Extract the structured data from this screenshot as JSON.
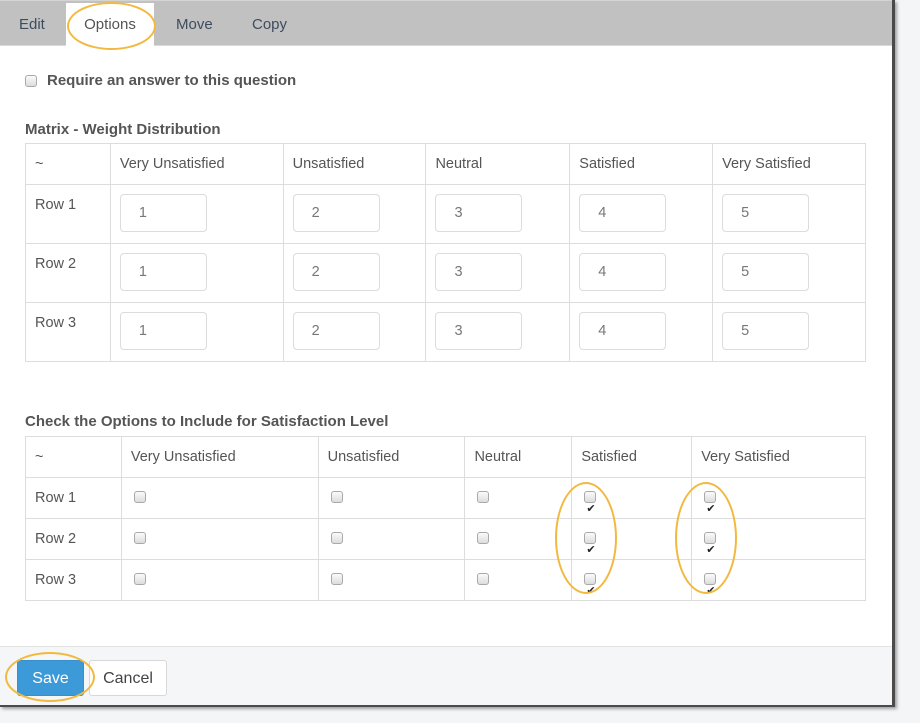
{
  "tabs": [
    {
      "label": "Edit",
      "active": false
    },
    {
      "label": "Options",
      "active": true
    },
    {
      "label": "Move",
      "active": false
    },
    {
      "label": "Copy",
      "active": false
    }
  ],
  "require_answer": {
    "label": "Require an answer to this question",
    "checked": false
  },
  "weights": {
    "title": "Matrix - Weight Distribution",
    "corner": "~",
    "columns": [
      "Very Unsatisfied",
      "Unsatisfied",
      "Neutral",
      "Satisfied",
      "Very Satisfied"
    ],
    "rows": [
      {
        "label": "Row 1",
        "values": [
          "1",
          "2",
          "3",
          "4",
          "5"
        ]
      },
      {
        "label": "Row 2",
        "values": [
          "1",
          "2",
          "3",
          "4",
          "5"
        ]
      },
      {
        "label": "Row 3",
        "values": [
          "1",
          "2",
          "3",
          "4",
          "5"
        ]
      }
    ]
  },
  "include": {
    "title": "Check the Options to Include for Satisfaction Level",
    "corner": "~",
    "columns": [
      "Very Unsatisfied",
      "Unsatisfied",
      "Neutral",
      "Satisfied",
      "Very Satisfied"
    ],
    "rows": [
      {
        "label": "Row 1",
        "checked": [
          false,
          false,
          false,
          true,
          true
        ]
      },
      {
        "label": "Row 2",
        "checked": [
          false,
          false,
          false,
          true,
          true
        ]
      },
      {
        "label": "Row 3",
        "checked": [
          false,
          false,
          false,
          true,
          true
        ]
      }
    ]
  },
  "footer": {
    "save_label": "Save",
    "cancel_label": "Cancel"
  },
  "colors": {
    "accent": "#3d9ad9",
    "highlight": "#f2b940",
    "tabbar": "#c1c1c1"
  }
}
